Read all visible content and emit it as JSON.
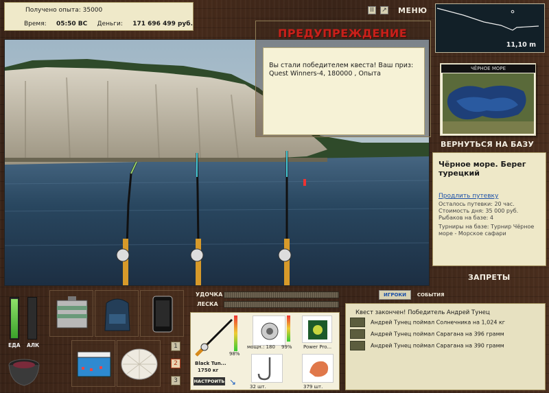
{
  "stats": {
    "exp_label": "Получено опыта:",
    "exp_value": "35000",
    "time_label": "Время:",
    "time_value": "05:50 ВС",
    "money_label": "Деньги:",
    "money_value": "171 696 499 руб."
  },
  "topbar": {
    "pause_icon": "II",
    "settings_icon": "↗",
    "menu_label": "МЕНЮ"
  },
  "depth": {
    "value": "11,10 m"
  },
  "warning": {
    "title": "ПРЕДУПРЕЖДЕНИЕ",
    "line1": "Вы стали победителем квеста! Ваш приз:",
    "line2": "Quest Winners-4, 180000 , Опыта"
  },
  "map": {
    "header": "ЧЁРНОЕ МОРЕ"
  },
  "nav": {
    "return_label": "ВЕРНУТЬСЯ НА БАЗУ",
    "bans_label": "ЗАПРЕТЫ"
  },
  "location": {
    "name": "Чёрное море. Берег турецкий",
    "extend_link": "Продлить путевку",
    "remaining": "Осталось путевки: 20 час.",
    "day_cost": "Стоимость дня: 35 000 руб.",
    "fishers": "Рыбаков на базе: 4",
    "tournaments": "Турниры на базе: Турнир Чёрное море - Морское сафари"
  },
  "meters": {
    "food_label": "ЕДА",
    "alc_label": "АЛК",
    "food_level": 0.95,
    "alc_level": 0.0
  },
  "pages": [
    "1",
    "2",
    "3"
  ],
  "bars": {
    "rod_label": "УДОЧКА",
    "line_label": "ЛЕСКА"
  },
  "gear": {
    "rod_name": "Black Tun...",
    "rod_weight": "1750 кг",
    "rod_pct": "98%",
    "setup_button": "НАСТРОИТЬ",
    "reel_label": "мощн.: 180",
    "reel_pct": "99%",
    "line_name": "Power Pro...",
    "hook_qty": "32 шт.",
    "bait_qty": "379 шт."
  },
  "events": {
    "tab_players": "ИГРОКИ",
    "tab_events": "СОБЫТИЯ",
    "message": "Квест закончен! Победитель Андрей Тунец",
    "items": [
      "Андрей Тунец поймал Солнечника на 1,024 кг",
      "Андрей Тунец поймал Сарагана на 396 грамм",
      "Андрей Тунец поймал Сарагана на 390 грамм"
    ]
  }
}
